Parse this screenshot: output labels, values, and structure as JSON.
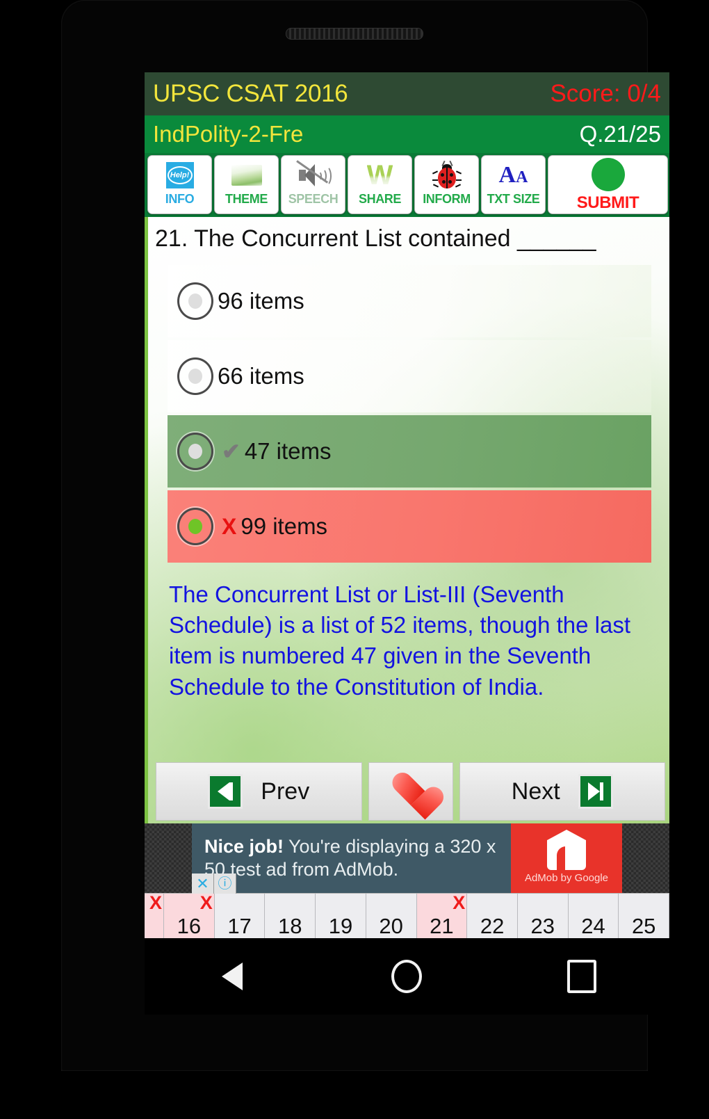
{
  "device": {
    "speaker_grille": "speaker-grille",
    "nav": {
      "back": "back-triangle-icon",
      "home": "home-circle-icon",
      "recents": "recents-square-icon"
    }
  },
  "title_bar": {
    "app_title": "UPSC CSAT 2016",
    "score": "Score: 0/4",
    "title_color": "#f2e53c",
    "score_color": "#ff1a1a",
    "background": "#2e4a33"
  },
  "subject_bar": {
    "subject": "IndPolity-2-Fre",
    "counter": "Q.21/25",
    "background": "#0a8a3c"
  },
  "toolbar": {
    "buttons": [
      {
        "label": "INFO",
        "icon": "help-bubble-icon"
      },
      {
        "label": "THEME",
        "icon": "landscape-thumbnail-icon"
      },
      {
        "label": "SPEECH",
        "icon": "speaker-muted-icon"
      },
      {
        "label": "SHARE",
        "icon": "share-w-icon"
      },
      {
        "label": "INFORM",
        "icon": "ladybug-icon"
      },
      {
        "label": "TXT SIZE",
        "icon": "font-size-aa-icon"
      },
      {
        "label": "SUBMIT",
        "icon": "green-circle-icon"
      }
    ]
  },
  "question": {
    "number": "21.",
    "text": "21. The Concurrent List contained ______",
    "options": [
      {
        "text": "96 items",
        "state": "none",
        "mark": "",
        "selected": false
      },
      {
        "text": "66 items",
        "state": "none",
        "mark": "",
        "selected": false
      },
      {
        "text": "47 items",
        "state": "correct",
        "mark": "✔",
        "selected": false
      },
      {
        "text": "99 items",
        "state": "wrong",
        "mark": "X",
        "selected": true
      }
    ],
    "explanation": "The Concurrent List or List-III (Seventh Schedule) is a list of 52 items, though the last item is numbered 47 given in the Seventh Schedule to the Constitution of India.",
    "explanation_color": "#1313e0"
  },
  "nav_buttons": {
    "prev_label": "Prev",
    "next_label": "Next",
    "prev_icon": "skip-to-first-icon",
    "next_icon": "skip-to-last-icon",
    "favorite_icon": "heart-icon"
  },
  "ad": {
    "headline": "Nice job!",
    "body": " You're displaying a 320 x 50 test ad from AdMob.",
    "logo_caption": "AdMob by Google",
    "logo_icon": "admob-logo-icon",
    "close_label": "✕",
    "info_label": "ⓘ",
    "brand_color": "#e8332a",
    "body_color": "#3f5966"
  },
  "question_strip": {
    "numbers": [
      {
        "label": "16",
        "marked": true,
        "xmark": "X"
      },
      {
        "label": "17",
        "marked": false,
        "xmark": ""
      },
      {
        "label": "18",
        "marked": false,
        "xmark": ""
      },
      {
        "label": "19",
        "marked": false,
        "xmark": ""
      },
      {
        "label": "20",
        "marked": false,
        "xmark": ""
      },
      {
        "label": "21",
        "marked": true,
        "xmark": "X"
      },
      {
        "label": "22",
        "marked": false,
        "xmark": ""
      },
      {
        "label": "23",
        "marked": false,
        "xmark": ""
      },
      {
        "label": "24",
        "marked": false,
        "xmark": ""
      },
      {
        "label": "25",
        "marked": false,
        "xmark": ""
      }
    ],
    "leading_xmark": "X"
  }
}
